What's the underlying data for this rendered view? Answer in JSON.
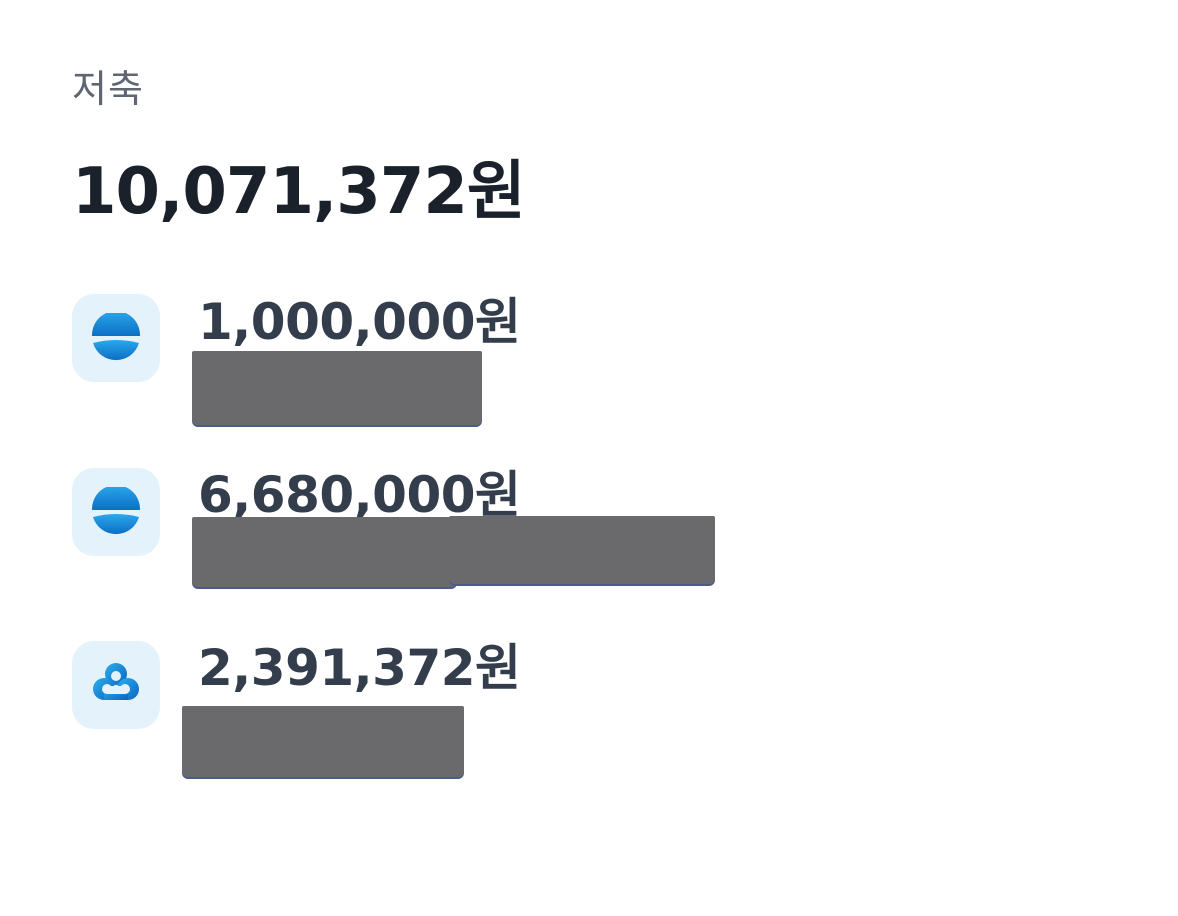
{
  "section": {
    "label": "저축",
    "total": "10,071,372원"
  },
  "accounts": [
    {
      "icon": "bank-semicircle-icon",
      "amount": "1,000,000원"
    },
    {
      "icon": "bank-semicircle-icon",
      "amount": "6,680,000원"
    },
    {
      "icon": "cloud-clover-bank-icon",
      "amount": "2,391,372원"
    }
  ],
  "colors": {
    "accent_blue": "#1a8ad8",
    "icon_bg": "#e4f2fc",
    "label_gray": "#5f6672",
    "total_text": "#1b212b",
    "amount_text": "#333d4b",
    "redaction": "#6a6a6c"
  }
}
